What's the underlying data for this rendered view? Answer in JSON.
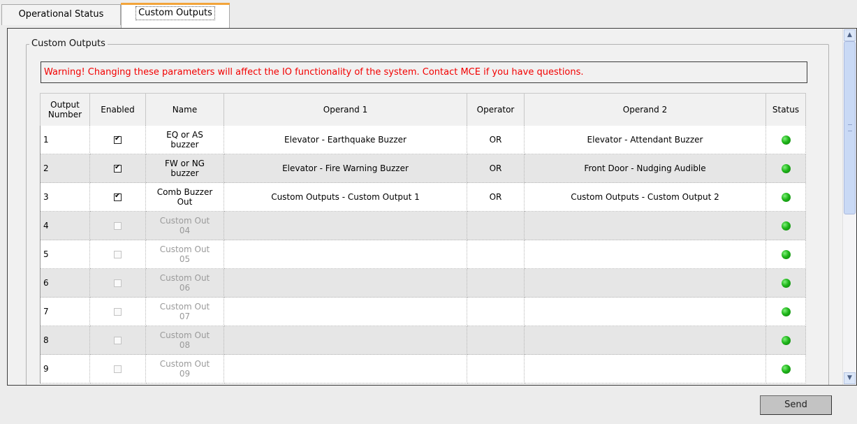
{
  "tabs": [
    {
      "label": "Operational Status",
      "active": false
    },
    {
      "label": "Custom Outputs",
      "active": true
    }
  ],
  "group": {
    "title": "Custom Outputs"
  },
  "warning": "Warning! Changing these parameters will affect the IO functionality of the system. Contact MCE if you have questions.",
  "table": {
    "headers": {
      "output_number": [
        "Output",
        "Number"
      ],
      "enabled": "Enabled",
      "name": "Name",
      "operand1": "Operand 1",
      "operator": "Operator",
      "operand2": "Operand 2",
      "status": "Status"
    },
    "rows": [
      {
        "number": "1",
        "enabled": true,
        "name": [
          "EQ or AS",
          "buzzer"
        ],
        "operand1": "Elevator - Earthquake Buzzer",
        "operator": "OR",
        "operand2": "Elevator - Attendant Buzzer",
        "status_color": "#1fb61a"
      },
      {
        "number": "2",
        "enabled": true,
        "name": [
          "FW or NG",
          "buzzer"
        ],
        "operand1": "Elevator - Fire Warning Buzzer",
        "operator": "OR",
        "operand2": "Front Door - Nudging Audible",
        "status_color": "#1fb61a"
      },
      {
        "number": "3",
        "enabled": true,
        "name": [
          "Comb Buzzer",
          "Out"
        ],
        "operand1": "Custom Outputs - Custom Output 1",
        "operator": "OR",
        "operand2": "Custom Outputs - Custom Output 2",
        "status_color": "#1fb61a"
      },
      {
        "number": "4",
        "enabled": false,
        "name": [
          "Custom Out",
          "04"
        ],
        "operand1": "",
        "operator": "",
        "operand2": "",
        "status_color": "#1fb61a"
      },
      {
        "number": "5",
        "enabled": false,
        "name": [
          "Custom Out",
          "05"
        ],
        "operand1": "",
        "operator": "",
        "operand2": "",
        "status_color": "#1fb61a"
      },
      {
        "number": "6",
        "enabled": false,
        "name": [
          "Custom Out",
          "06"
        ],
        "operand1": "",
        "operator": "",
        "operand2": "",
        "status_color": "#1fb61a"
      },
      {
        "number": "7",
        "enabled": false,
        "name": [
          "Custom Out",
          "07"
        ],
        "operand1": "",
        "operator": "",
        "operand2": "",
        "status_color": "#1fb61a"
      },
      {
        "number": "8",
        "enabled": false,
        "name": [
          "Custom Out",
          "08"
        ],
        "operand1": "",
        "operator": "",
        "operand2": "",
        "status_color": "#1fb61a"
      },
      {
        "number": "9",
        "enabled": false,
        "name": [
          "Custom Out",
          "09"
        ],
        "operand1": "",
        "operator": "",
        "operand2": "",
        "status_color": "#1fb61a"
      }
    ]
  },
  "buttons": {
    "send": "Send"
  },
  "icons": {
    "scroll_up": "chevron-up-icon",
    "scroll_down": "chevron-down-icon",
    "status": "status-led-icon",
    "checkbox": "checkbox-icon"
  }
}
